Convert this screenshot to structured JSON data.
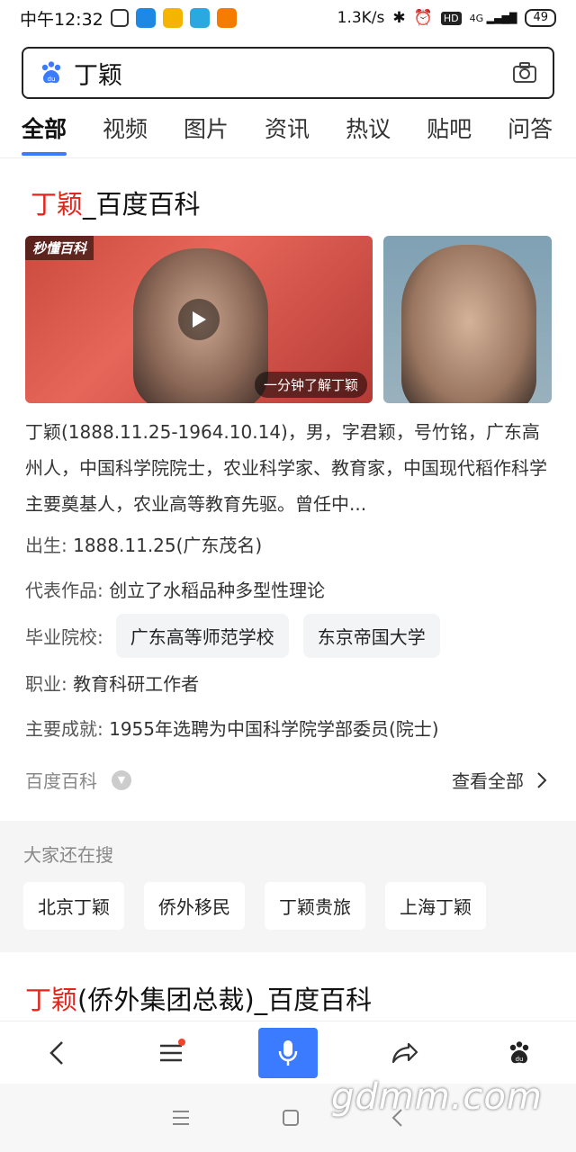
{
  "status": {
    "time": "中午12:32",
    "net_speed": "1.3K/s",
    "hd": "HD",
    "signal": "4G",
    "battery": "49"
  },
  "search": {
    "query": "丁颖"
  },
  "tabs": [
    "全部",
    "视频",
    "图片",
    "资讯",
    "热议",
    "贴吧",
    "问答"
  ],
  "result1": {
    "title_highlight": "丁颖",
    "title_rest": "_百度百科",
    "video_logo": "秒懂百科",
    "video_caption": "一分钟了解丁颖",
    "summary": "丁颖(1888.11.25-1964.10.14)，男，字君颖，号竹铭，广东高州人，中国科学院院士，农业科学家、教育家，中国现代稻作科学主要奠基人，农业高等教育先驱。曾任中...",
    "born_label": "出生:",
    "born_value": "1888.11.25(广东茂名)",
    "works_label": "代表作品:",
    "works_value": "创立了水稻品种多型性理论",
    "school_label": "毕业院校:",
    "school_1": "广东高等师范学校",
    "school_2": "东京帝国大学",
    "job_label": "职业:",
    "job_value": "教育科研工作者",
    "achieve_label": "主要成就:",
    "achieve_value": "1955年选聘为中国科学院学部委员(院士)",
    "source": "百度百科",
    "view_all": "查看全部"
  },
  "also_search": {
    "heading": "大家还在搜",
    "items": [
      "北京丁颖",
      "侨外移民",
      "丁颖贵旅",
      "上海丁颖"
    ]
  },
  "result2": {
    "title_highlight": "丁颖",
    "title_rest": "(侨外集团总裁)_百度百科"
  },
  "watermark": "gdmm.com",
  "colors": {
    "accent": "#3a7bff",
    "highlight": "#e0261d"
  }
}
